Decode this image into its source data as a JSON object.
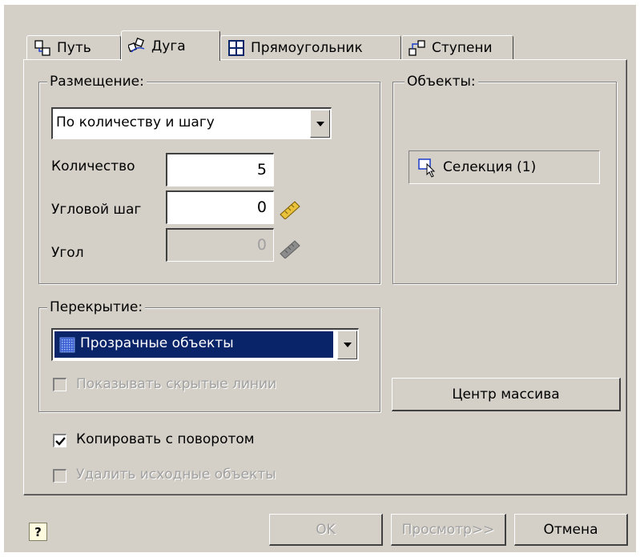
{
  "tabs": [
    {
      "label": "Путь",
      "icon": "path-icon"
    },
    {
      "label": "Дуга",
      "icon": "arc-icon",
      "active": true
    },
    {
      "label": "Прямоугольник",
      "icon": "grid-icon"
    },
    {
      "label": "Ступени",
      "icon": "steps-icon"
    }
  ],
  "placement": {
    "group_label": "Размещение:",
    "mode_value": "По количеству и шагу",
    "count_label": "Количество",
    "count_value": "5",
    "angle_step_label": "Угловой шаг",
    "angle_step_value": "0",
    "angle_label": "Угол",
    "angle_value": "0"
  },
  "objects": {
    "group_label": "Объекты:",
    "selection_label": "Селекция (1)"
  },
  "overlap": {
    "group_label": "Перекрытие:",
    "mode_value": "Прозрачные объекты",
    "show_hidden_lines_label": "Показывать скрытые линии",
    "show_hidden_lines_checked": false
  },
  "array_center_button": "Центр массива",
  "copy_with_rotation_label": "Копировать с поворотом",
  "copy_with_rotation_checked": true,
  "delete_source_label": "Удалить исходные объекты",
  "delete_source_checked": false,
  "footer": {
    "ok_label": "OK",
    "preview_label": "Просмотр>>",
    "cancel_label": "Отмена"
  },
  "colors": {
    "dialog_bg": "#d4d0c8",
    "selection_bg": "#0a246a"
  }
}
